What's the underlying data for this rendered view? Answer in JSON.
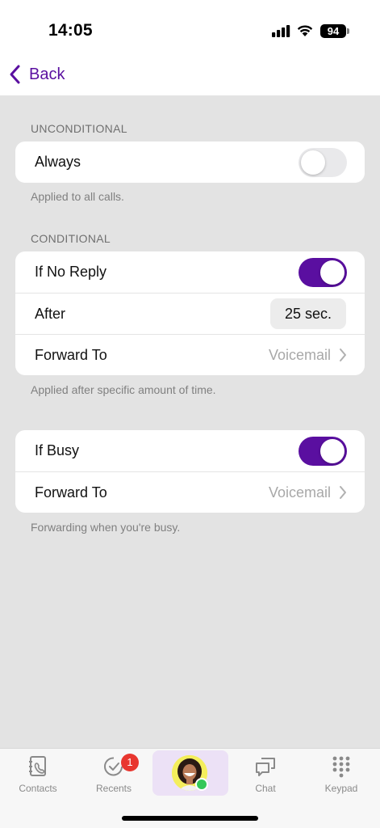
{
  "status_bar": {
    "time": "14:05",
    "battery": "94"
  },
  "nav": {
    "back_label": "Back"
  },
  "unconditional": {
    "header": "UNCONDITIONAL",
    "always_label": "Always",
    "always_enabled": false,
    "footer": "Applied to all calls."
  },
  "conditional": {
    "header": "CONDITIONAL",
    "no_reply_label": "If No Reply",
    "no_reply_enabled": true,
    "after_label": "After",
    "after_value": "25 sec.",
    "forward_label": "Forward To",
    "forward_value": "Voicemail",
    "footer": "Applied after specific amount of time."
  },
  "busy": {
    "busy_label": "If Busy",
    "busy_enabled": true,
    "forward_label": "Forward To",
    "forward_value": "Voicemail",
    "footer": "Forwarding when you're busy."
  },
  "tabs": {
    "contacts": "Contacts",
    "recents": "Recents",
    "recents_badge": "1",
    "chat": "Chat",
    "keypad": "Keypad"
  },
  "colors": {
    "accent": "#5a0fa0",
    "background": "#e3e3e3",
    "badge": "#e8362f",
    "presence": "#35c759"
  },
  "icons": {
    "back": "chevron-left-icon",
    "contacts": "contacts-book-icon",
    "recents": "recents-check-icon",
    "chat": "chat-bubbles-icon",
    "keypad": "keypad-dots-icon"
  }
}
